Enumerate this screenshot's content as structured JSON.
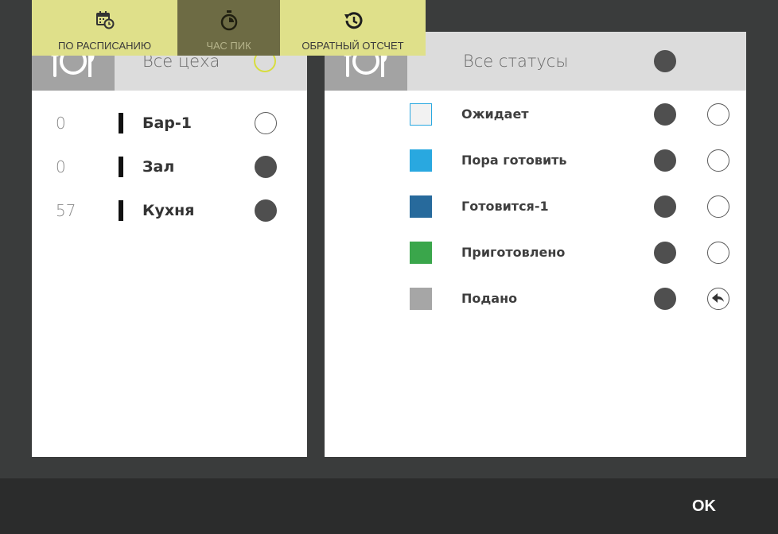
{
  "workshops_panel": {
    "title": "Все цеха",
    "items": [
      {
        "count": "0",
        "name": "Бар-1",
        "selected": false
      },
      {
        "count": "0",
        "name": "Зал",
        "selected": true
      },
      {
        "count": "57",
        "name": "Кухня",
        "selected": true
      }
    ]
  },
  "statuses_panel": {
    "title": "Все статусы",
    "items": [
      {
        "name": "Ожидает",
        "color": "#f2f2f2"
      },
      {
        "name": "Пора готовить",
        "color": "#29a8e0"
      },
      {
        "name": "Готовится-1",
        "color": "#276a9c"
      },
      {
        "name": "Приготовлено",
        "color": "#3aa64b"
      },
      {
        "name": "Подано",
        "color": "#a6a6a6"
      }
    ]
  },
  "bottom_bar": {
    "schedule_label": "ПО РАСПИСАНИЮ",
    "peak_label": "ЧАС ПИК",
    "reverse_label": "ОБРАТНЫЙ ОТСЧЕТ",
    "ok_label": "OK"
  },
  "colors": {
    "accent_yellow": "#dfe08a",
    "active_dark_olive": "#6d6b44",
    "background": "#3a3c3c"
  }
}
